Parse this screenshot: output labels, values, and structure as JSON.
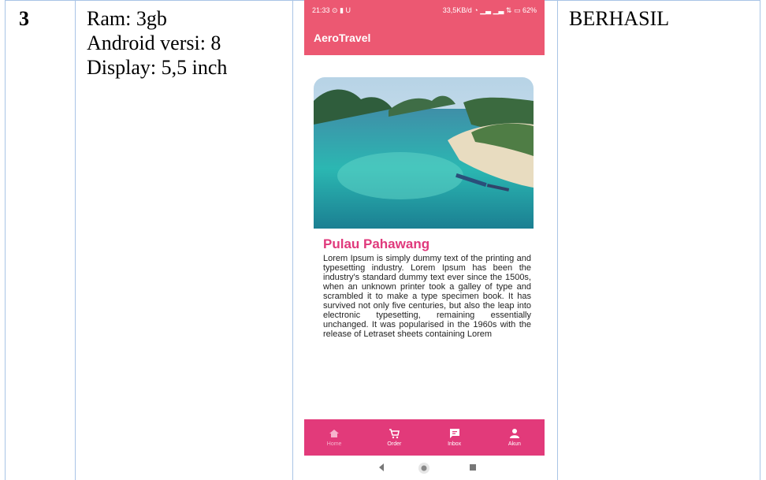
{
  "row": {
    "number": "3",
    "specs": [
      "Ram: 3gb",
      "Android versi: 8",
      "Display: 5,5 inch"
    ],
    "status": "BERHASIL"
  },
  "phone": {
    "status_bar": {
      "time": "21:33 ⊙ ▮ U",
      "right": "33,5KB/d ◔ ▁▃ ▁▃ ⇅ ▭ 62%"
    },
    "app_title": "AeroTravel",
    "place": {
      "name": "Pulau Pahawang",
      "description": "Lorem Ipsum is simply dummy text of the printing and typesetting industry. Lorem Ipsum has been the industry's standard dummy text ever since the 1500s, when an unknown printer took a galley of type and scrambled it to make a type specimen book. It has survived not only five centuries, but also the leap into electronic typesetting, remaining essentially unchanged. It was popularised in the 1960s with the release of Letraset sheets containing Lorem"
    },
    "bottom_nav": [
      {
        "label": "Home",
        "icon": "home-icon",
        "active": false
      },
      {
        "label": "Order",
        "icon": "cart-icon",
        "active": true
      },
      {
        "label": "Inbox",
        "icon": "chat-icon",
        "active": true
      },
      {
        "label": "Akun",
        "icon": "person-icon",
        "active": true
      }
    ],
    "system_nav": [
      "back-icon",
      "home-circle-icon",
      "recents-icon"
    ]
  },
  "colors": {
    "appbar": "#ec5872",
    "accent": "#e23a7a",
    "title_pink": "#e0397c",
    "grid": "#a9c4e6"
  }
}
